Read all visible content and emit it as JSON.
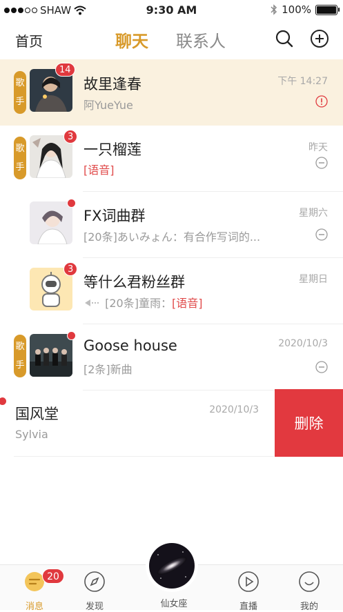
{
  "status_bar": {
    "carrier": "SHAW",
    "time": "9:30 AM",
    "battery": "100%"
  },
  "nav": {
    "home": "首页",
    "tab_chat": "聊天",
    "tab_contacts": "联系人"
  },
  "conversations": [
    {
      "name": "故里逢春",
      "preview": "阿YueYue",
      "time": "下午 14:27",
      "badge": "14",
      "tag": [
        "歌",
        "手"
      ],
      "status": "alert",
      "highlight": true
    },
    {
      "name": "一只榴莲",
      "preview_red": "[语音]",
      "time": "昨天",
      "badge": "3",
      "tag": [
        "歌",
        "手"
      ],
      "status": "muted"
    },
    {
      "name": "FX词曲群",
      "preview": "[20条]あいみょん：有合作写词的...",
      "time": "星期六",
      "dot": true,
      "status": "muted"
    },
    {
      "name": "等什么君粉丝群",
      "preview_prefix": "[20条]童雨：",
      "preview_red": "[语音]",
      "time": "星期日",
      "badge": "3",
      "status": "none"
    },
    {
      "name": "Goose house",
      "preview": "[2条]新曲",
      "time": "2020/10/3",
      "dot": true,
      "tag": [
        "歌",
        "手"
      ],
      "status": "muted"
    },
    {
      "name": "国风堂",
      "preview": "Sylvia",
      "time": "2020/10/3",
      "dot": true
    }
  ],
  "delete_label": "删除",
  "tabbar": {
    "messages": "消息",
    "messages_badge": "20",
    "discover": "发现",
    "center": "仙女座",
    "live": "直播",
    "mine": "我的"
  },
  "colors": {
    "accent": "#d89a2a",
    "badge": "#e0393e",
    "delete": "#e2393f",
    "highlight_bg": "#faf1df"
  }
}
